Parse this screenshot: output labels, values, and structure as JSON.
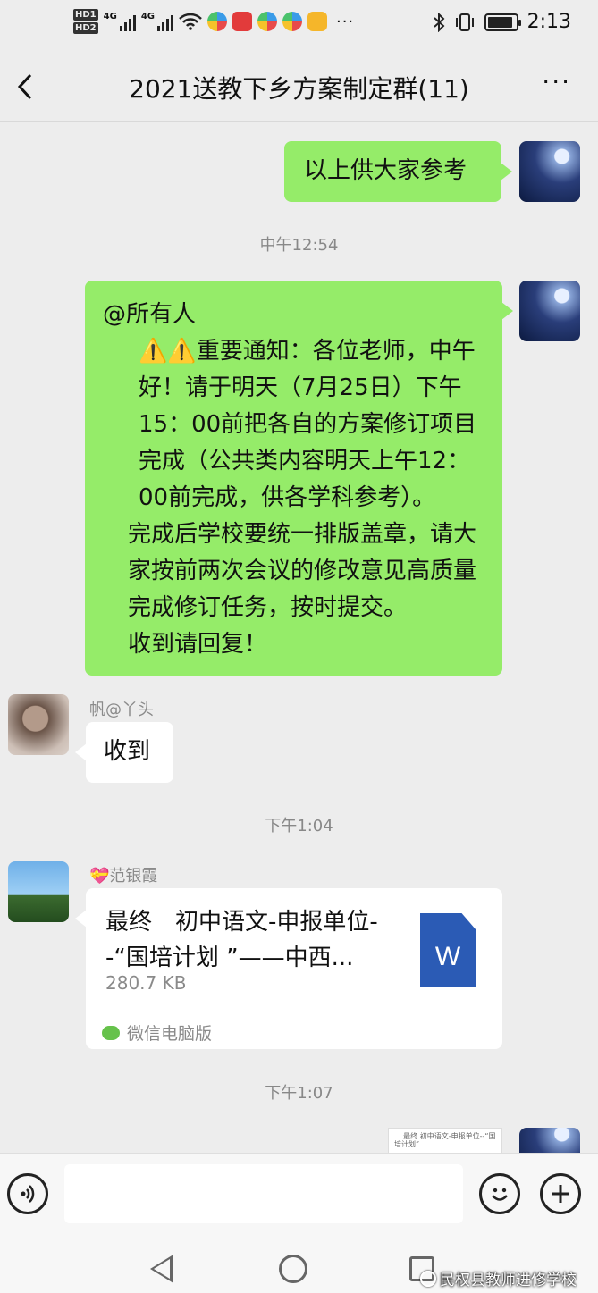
{
  "status_bar": {
    "hd1": "HD1",
    "hd2": "HD2",
    "net1": "4G",
    "net2": "4G",
    "more": "···",
    "time": "2:13",
    "battery_percent": 90
  },
  "header": {
    "title": "2021送教下乡方案制定群(11)",
    "more": "···"
  },
  "messages": {
    "m1": {
      "text": "以上供大家参考"
    },
    "t1": "中午12:54",
    "m2": {
      "mention": "@所有人",
      "line1": "⚠️⚠️重要通知：各位老师，中午好！请于明天（7月25日）下午15：00前把各自的方案修订项目完成（公共类内容明天上午12：00前完成，供各学科参考）。",
      "line2": "完成后学校要统一排版盖章，请大家按前两次会议的修改意见高质量完成修订任务，按时提交。",
      "line3": "收到请回复！"
    },
    "m3": {
      "sender": "帆@丫头",
      "text": "收到"
    },
    "t2": "下午1:04",
    "m4": {
      "sender": "💝范银霞",
      "file_name": "最终　初中语文-申报单位--“国培计划 ”——中西...",
      "file_size": "280.7 KB",
      "file_icon_letter": "W",
      "source": "微信电脑版"
    },
    "t3": "下午1:07",
    "m5": {
      "thumb_text": "... 最终 初中语文-申报单位--“国培计划”..."
    }
  },
  "watermark": "民权县教师进修学校",
  "colors": {
    "green_bubble": "#95ec69",
    "background": "#ededed",
    "word_blue": "#2b5bb5"
  }
}
